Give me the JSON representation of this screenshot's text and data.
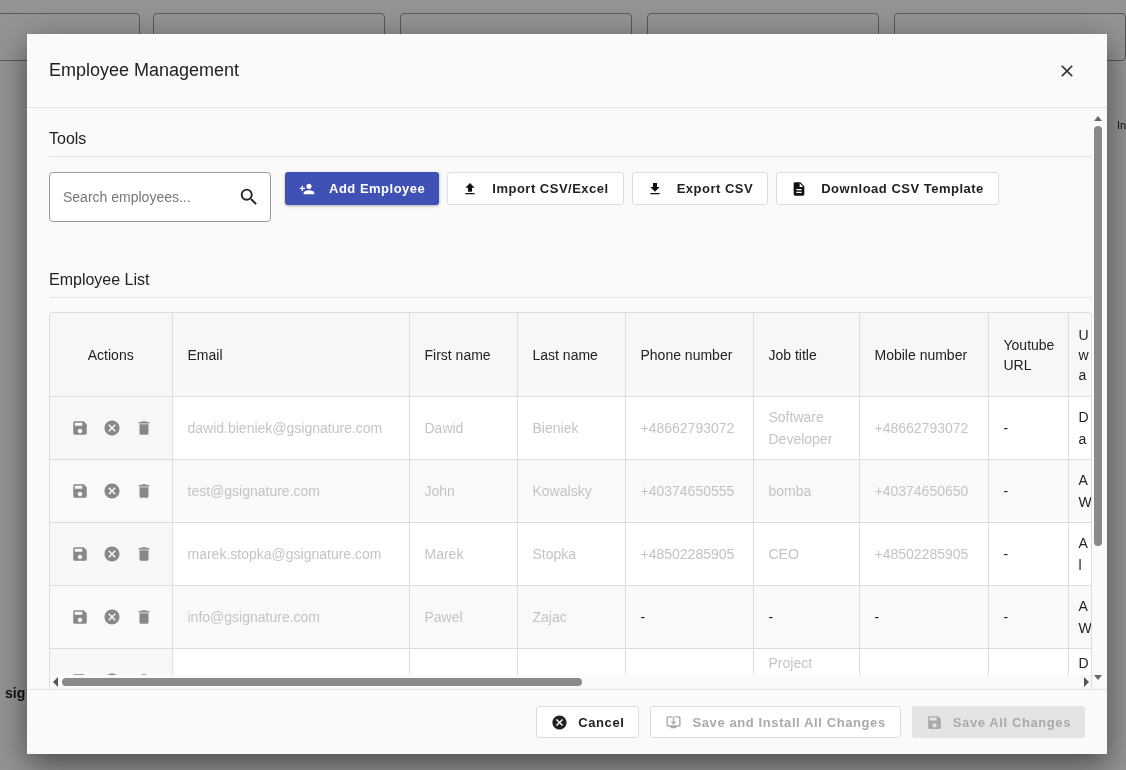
{
  "background": {
    "fragments": [
      "sig",
      "In"
    ]
  },
  "dialog": {
    "title": "Employee Management",
    "tools_heading": "Tools",
    "search": {
      "placeholder": "Search employees..."
    },
    "toolbar_buttons": [
      {
        "label": "Add Employee",
        "kind": "primary"
      },
      {
        "label": "Import CSV/Excel",
        "kind": "outlined"
      },
      {
        "label": "Export CSV",
        "kind": "outlined"
      },
      {
        "label": "Download CSV Template",
        "kind": "outlined"
      }
    ],
    "list_heading": "Employee List",
    "table": {
      "columns": [
        "Actions",
        "Email",
        "First name",
        "Last name",
        "Phone number",
        "Job title",
        "Mobile number",
        "Youtube URL",
        "U w a"
      ],
      "rows": [
        {
          "cells": [
            {
              "kind": "actions"
            },
            {
              "t": "dawid.bieniek@gsignature.com",
              "blurred": true
            },
            {
              "t": "Dawid",
              "blurred": true
            },
            {
              "t": "Bieniek",
              "blurred": true
            },
            {
              "t": "+48662793072",
              "blurred": true
            },
            {
              "t": "Software Developer",
              "blurred": true
            },
            {
              "t": "+48662793072",
              "blurred": true
            },
            {
              "t": "-",
              "blurred": false
            },
            {
              "t": "D a",
              "blurred": false
            }
          ]
        },
        {
          "cells": [
            {
              "kind": "actions"
            },
            {
              "t": "test@gsignature.com",
              "blurred": true
            },
            {
              "t": "John",
              "blurred": true
            },
            {
              "t": "Kowalsky",
              "blurred": true
            },
            {
              "t": "+40374650555",
              "blurred": true
            },
            {
              "t": "bomba",
              "blurred": true
            },
            {
              "t": "+40374650650",
              "blurred": true
            },
            {
              "t": "-",
              "blurred": false
            },
            {
              "t": "A W",
              "blurred": false
            }
          ]
        },
        {
          "cells": [
            {
              "kind": "actions"
            },
            {
              "t": "marek.stopka@gsignature.com",
              "blurred": true
            },
            {
              "t": "Marek",
              "blurred": true
            },
            {
              "t": "Stopka",
              "blurred": true
            },
            {
              "t": "+48502285905",
              "blurred": true
            },
            {
              "t": "CEO",
              "blurred": true
            },
            {
              "t": "+48502285905",
              "blurred": true
            },
            {
              "t": "-",
              "blurred": false
            },
            {
              "t": "A l",
              "blurred": false
            }
          ]
        },
        {
          "cells": [
            {
              "kind": "actions"
            },
            {
              "t": "info@gsignature.com",
              "blurred": true
            },
            {
              "t": "Pawel",
              "blurred": true
            },
            {
              "t": "Zajac",
              "blurred": true
            },
            {
              "t": "-",
              "blurred": false
            },
            {
              "t": "-",
              "blurred": false
            },
            {
              "t": "-",
              "blurred": false
            },
            {
              "t": "-",
              "blurred": false
            },
            {
              "t": "A W",
              "blurred": false
            }
          ]
        },
        {
          "cells": [
            {
              "kind": "actions"
            },
            null,
            null,
            null,
            null,
            {
              "t": "Project",
              "blurred": true
            },
            null,
            null,
            {
              "t": "D",
              "blurred": false
            }
          ]
        }
      ]
    },
    "footer_buttons": [
      {
        "label": "Cancel",
        "kind": "outlined",
        "disabled": false
      },
      {
        "label": "Save and Install All Changes",
        "kind": "outlined",
        "disabled": true
      },
      {
        "label": "Save All Changes",
        "kind": "filled",
        "disabled": true
      }
    ]
  }
}
